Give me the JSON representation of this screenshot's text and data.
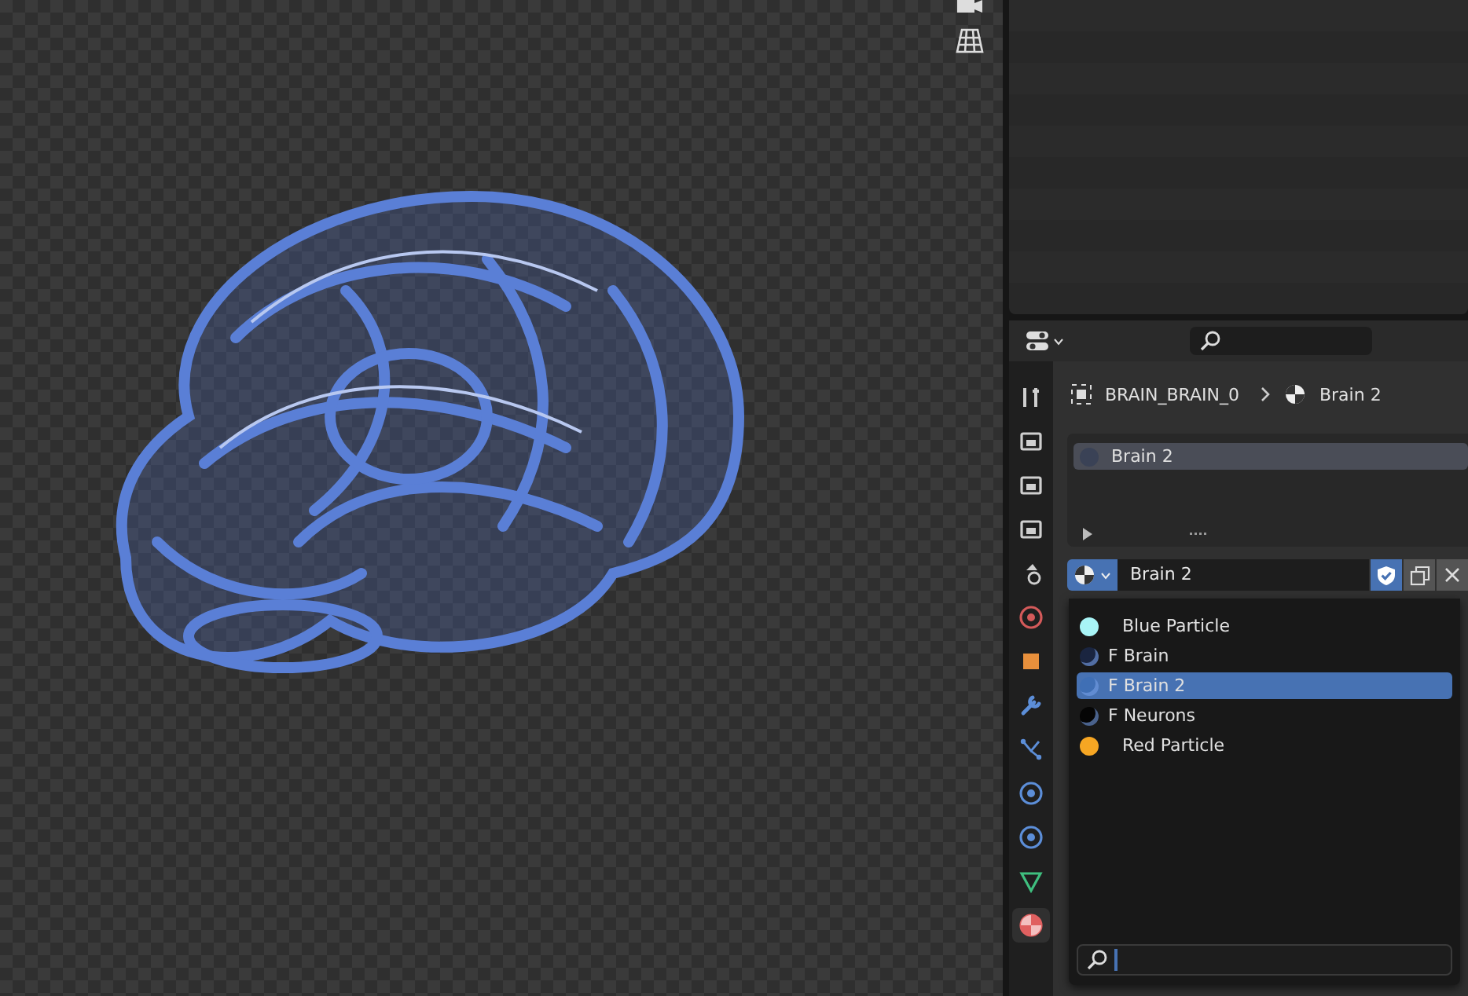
{
  "properties": {
    "breadcrumb": {
      "object": "BRAIN_BRAIN_0",
      "material": "Brain 2"
    },
    "tabs": [
      {
        "kind": "tool",
        "selected": false
      },
      {
        "kind": "render",
        "selected": false
      },
      {
        "kind": "output",
        "selected": false
      },
      {
        "kind": "view-layer",
        "selected": false
      },
      {
        "kind": "scene",
        "selected": false
      },
      {
        "kind": "world",
        "selected": false
      },
      {
        "kind": "object",
        "selected": false
      },
      {
        "kind": "modifier",
        "selected": false
      },
      {
        "kind": "particles",
        "selected": false
      },
      {
        "kind": "physics",
        "selected": false
      },
      {
        "kind": "constraints",
        "selected": false
      },
      {
        "kind": "data",
        "selected": false
      },
      {
        "kind": "material",
        "selected": true
      }
    ],
    "material_slots": [
      {
        "name": "Brain 2",
        "selected": true
      }
    ],
    "material_field": {
      "value": "Brain 2",
      "fake_user": true
    },
    "material_menu": {
      "items": [
        {
          "name": "Blue Particle",
          "kind": "swatch",
          "color": "#a8f4f6",
          "selected": false
        },
        {
          "name": "F Brain",
          "kind": "sphere",
          "color": "#1a2540",
          "selected": false
        },
        {
          "name": "F Brain 2",
          "kind": "sphere",
          "color": "#3f6fb5",
          "selected": true
        },
        {
          "name": "F Neurons",
          "kind": "sphere",
          "color": "#050505",
          "selected": false
        },
        {
          "name": "Red Particle",
          "kind": "swatch",
          "color": "#f6a623",
          "selected": false
        }
      ]
    }
  }
}
